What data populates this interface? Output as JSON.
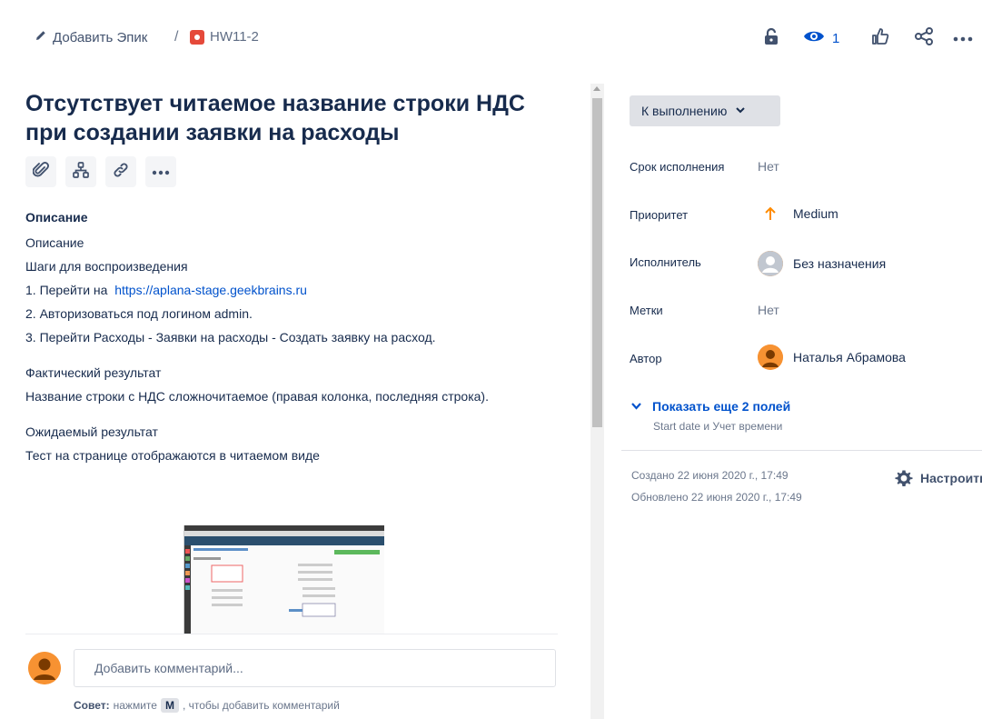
{
  "header": {
    "add_epic_label": "Добавить Эпик",
    "separator": "/",
    "issue_key": "HW11-2",
    "watch_count": "1"
  },
  "issue": {
    "title": "Отсутствует читаемое название строки НДС при создании заявки на расходы"
  },
  "description": {
    "heading": "Описание",
    "lines": [
      "Описание",
      "Шаги для воспроизведения",
      "1. Перейти на ",
      "2. Авторизоваться под логином admin.",
      "3. Перейти Расходы - Заявки на расходы - Создать заявку на расход.",
      "Фактический результат",
      "Название строки с НДС сложночитаемое (правая колонка, последняя строка).",
      "Ожидаемый результат",
      "Тест на странице отображаются в читаемом виде"
    ],
    "link": "https://aplana-stage.geekbrains.ru"
  },
  "comment": {
    "placeholder": "Добавить комментарий...",
    "tip_label": "Совет:",
    "tip_before": "нажмите",
    "tip_key": "M",
    "tip_after": ", чтобы добавить комментарий"
  },
  "status": {
    "label": "К выполнению"
  },
  "fields": {
    "due_label": "Срок исполнения",
    "due_value": "Нет",
    "priority_label": "Приоритет",
    "priority_value": "Medium",
    "assignee_label": "Исполнитель",
    "assignee_value": "Без назначения",
    "labels_label": "Метки",
    "labels_value": "Нет",
    "reporter_label": "Автор",
    "reporter_value": "Наталья Абрамова"
  },
  "more_fields": {
    "label": "Показать еще 2 полей",
    "sub": "Start date и Учет времени"
  },
  "meta": {
    "created": "Создано 22 июня 2020 г., 17:49",
    "updated": "Обновлено 22 июня 2020 г., 17:49",
    "configure": "Настроить"
  },
  "colors": {
    "accent": "#0052cc",
    "bug": "#e5493a",
    "priority": "#ff8b00",
    "avatar": "#f79232"
  }
}
